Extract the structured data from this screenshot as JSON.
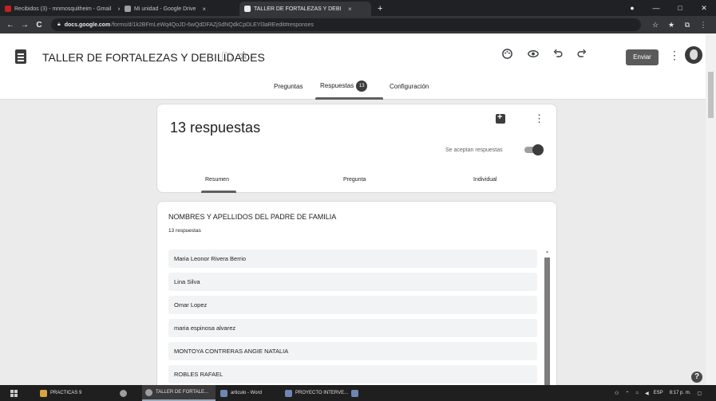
{
  "browser": {
    "tabs": [
      {
        "label": "Recibidos (3) - mnmosquitheim - Gmail",
        "close": "×",
        "favicon_color": "#c5221f"
      },
      {
        "label": "Mi unidad - Google Drive",
        "close": "×",
        "favicon_color": "#9aa0a6"
      },
      {
        "label": "TALLER DE FORTALEZAS Y DEBILIDADES",
        "close": "×",
        "favicon_color": "#e8eaed"
      }
    ],
    "new_tab": "+",
    "window_controls": [
      "●",
      "—",
      "□",
      "✕"
    ],
    "url_domain": "docs.google.com",
    "url_path": "/forms/d/1k2BFmLeWq4QoJD-6wQdDFAZjSdNQdkCpDLEYl3aREedit#responses",
    "nav": {
      "back": "←",
      "forward": "→",
      "reload": "C"
    },
    "omni_icons": [
      "☆",
      "★",
      "⧉",
      "⋮"
    ]
  },
  "form": {
    "title": "TALLER DE FORTALEZAS Y DEBILIDADES",
    "header_icons": [
      "palette-icon",
      "preview-icon",
      "undo-icon",
      "redo-icon"
    ],
    "send_label": "Enviar",
    "tabs": [
      {
        "label": "Preguntas"
      },
      {
        "label": "Respuestas",
        "badge": "13"
      },
      {
        "label": "Configuración"
      }
    ]
  },
  "summary": {
    "responses_title": "13 respuestas",
    "accepting_label": "Se aceptan respuestas",
    "subtabs": [
      "Resumen",
      "Pregunta",
      "Individual"
    ]
  },
  "question": {
    "title": "NOMBRES Y APELLIDOS DEL PADRE DE FAMILIA",
    "count": "13 respuestas",
    "answers": [
      "Maria Leonor Rivera Berrio",
      "Lina Silva",
      "Omar Lopez",
      "maria espinosa alvarez",
      "MONTOYA CONTRERAS ANGIE NATALIA",
      "ROBLES RAFAEL"
    ]
  },
  "taskbar": {
    "items": [
      {
        "label": "PRACTICAS 9"
      },
      {
        "label": "TALLER DE FORTALE..."
      },
      {
        "label": "articulo - Word"
      },
      {
        "label": "PROYECTO INTERVE..."
      }
    ],
    "tray": {
      "lang": "ESP",
      "time": "8:17 p. m."
    }
  }
}
